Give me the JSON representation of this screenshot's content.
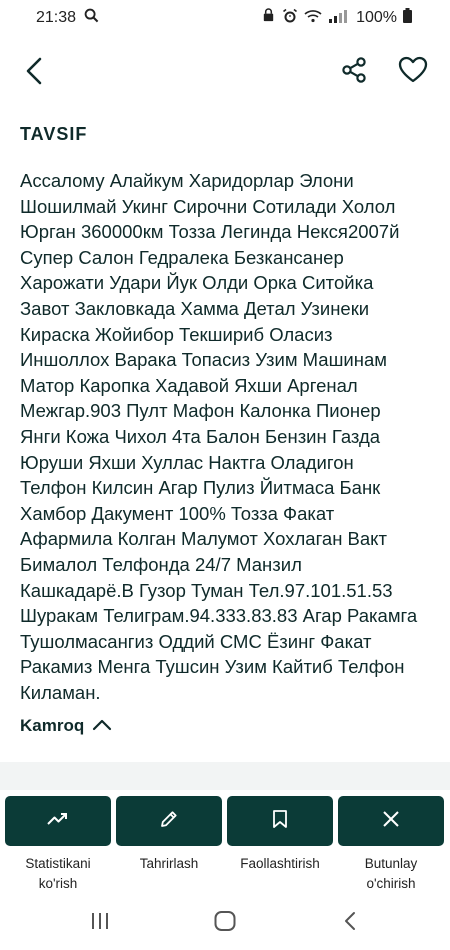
{
  "status": {
    "time": "21:38",
    "battery": "100%"
  },
  "section": {
    "title": "TAVSIF"
  },
  "description": "Ассалому Алайкум Харидорлар Элони\nШошилмай Укинг Сирочни Сотилади Холол\nЮрган 360000км Тозза Легинда Некся2007й\nСупер Салон Гедралека Безкансанер\nХарожати Удари Йук Олди Орка Ситойка\nЗавот Закловкада Хамма Детал Узинеки\nКираска Жойибор Текшириб Оласиз\nИншоллох Варака Топасиз Узим Машинам\nМатор Каропка Хадавой Яхши Аргенал\nМежгар.903 Пулт Мафон Калонка Пионер\nЯнги Кожа Чихол 4та Балон Бензин Газда\nЮруши Яхши Хуллас Нактга Оладигон\nТелфон Килсин Агар Пулиз Йитмаса Банк\nХамбор Дакумент 100% Тозза Факат\nАфармила Колган Малумот Хохлаган Вакт\nБималол Телфонда 24/7 Манзил\nКашкадарё.В Гузор Туман Тел.97.101.51.53\nШуракам Телиграм.94.333.83.83 Агар Ракамга\nТушолмасангиз Оддий СМС Ёзинг Факат\nРакамиз Менга Тушсин Узим Кайтиб Телфон\nКиламан.",
  "more_label": "Kamroq",
  "actions": [
    {
      "label": "Statistikani\nko'rish",
      "icon": "trending-up-icon"
    },
    {
      "label": "Tahrirlash",
      "icon": "pencil-icon"
    },
    {
      "label": "Faollashtirish",
      "icon": "bookmark-icon"
    },
    {
      "label": "Butunlay\no'chirish",
      "icon": "close-icon"
    }
  ],
  "colors": {
    "action_bg": "#0b3b37",
    "text": "#0f2a2a"
  }
}
